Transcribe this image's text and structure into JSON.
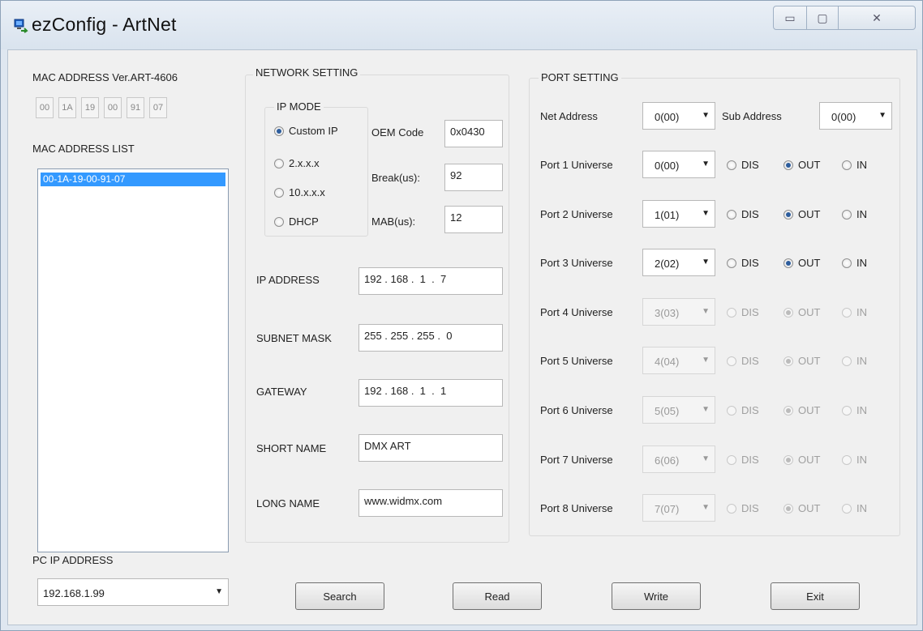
{
  "window": {
    "title": "ezConfig - ArtNet",
    "controls": {
      "minimize": "▭",
      "maximize": "▢",
      "close": "✕"
    }
  },
  "mac": {
    "label": "MAC ADDRESS  Ver.ART-4606",
    "bytes": [
      "00",
      "1A",
      "19",
      "00",
      "91",
      "07"
    ],
    "list_label": "MAC ADDRESS LIST",
    "list_items": [
      "00-1A-19-00-91-07"
    ]
  },
  "pc_ip": {
    "label": "PC IP ADDRESS",
    "value": "192.168.1.99"
  },
  "network": {
    "title": "NETWORK SETTING",
    "ip_mode": {
      "title": "IP MODE",
      "options": [
        "Custom IP",
        "2.x.x.x",
        "10.x.x.x",
        "DHCP"
      ],
      "selected": "Custom IP"
    },
    "oem_code": {
      "label": "OEM Code",
      "value": "0x0430"
    },
    "break": {
      "label": "Break(us):",
      "value": "92"
    },
    "mab": {
      "label": "MAB(us):",
      "value": "12"
    },
    "ip_address": {
      "label": "IP ADDRESS",
      "value": "192 . 168 .  1  .  7"
    },
    "subnet_mask": {
      "label": "SUBNET MASK",
      "value": "255 . 255 . 255 .  0"
    },
    "gateway": {
      "label": "GATEWAY",
      "value": "192 . 168 .  1  .  1"
    },
    "short_name": {
      "label": "SHORT NAME",
      "value": "DMX ART"
    },
    "long_name": {
      "label": "LONG NAME",
      "value": "www.widmx.com"
    }
  },
  "port": {
    "title": "PORT SETTING",
    "net_address": {
      "label": "Net Address",
      "value": "0(00)"
    },
    "sub_address": {
      "label": "Sub Address",
      "value": "0(00)"
    },
    "option_labels": {
      "dis": "DIS",
      "out": "OUT",
      "in": "IN"
    },
    "universes": [
      {
        "label": "Port 1 Universe",
        "value": "0(00)",
        "mode": "OUT",
        "enabled": true
      },
      {
        "label": "Port 2 Universe",
        "value": "1(01)",
        "mode": "OUT",
        "enabled": true
      },
      {
        "label": "Port 3 Universe",
        "value": "2(02)",
        "mode": "OUT",
        "enabled": true
      },
      {
        "label": "Port 4 Universe",
        "value": "3(03)",
        "mode": "OUT",
        "enabled": false
      },
      {
        "label": "Port 5 Universe",
        "value": "4(04)",
        "mode": "OUT",
        "enabled": false
      },
      {
        "label": "Port 6 Universe",
        "value": "5(05)",
        "mode": "OUT",
        "enabled": false
      },
      {
        "label": "Port 7 Universe",
        "value": "6(06)",
        "mode": "OUT",
        "enabled": false
      },
      {
        "label": "Port 8 Universe",
        "value": "7(07)",
        "mode": "OUT",
        "enabled": false
      }
    ]
  },
  "buttons": {
    "search": "Search",
    "read": "Read",
    "write": "Write",
    "exit": "Exit"
  },
  "colors": {
    "selection": "#3399ff",
    "radio_on": "#2d5d9d"
  }
}
